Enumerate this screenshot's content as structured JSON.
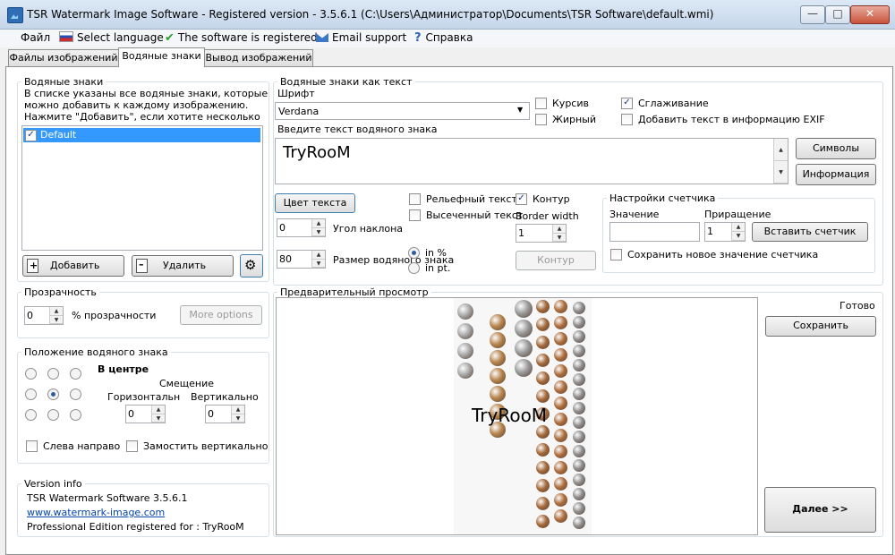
{
  "window": {
    "title": "TSR Watermark Image Software - Registered version - 3.5.6.1 (C:\\Users\\Администратор\\Documents\\TSR Software\\default.wmi)",
    "min_glyph": "—",
    "max_glyph": "□",
    "close_glyph": "✕"
  },
  "menu": {
    "file": "Файл",
    "language": "Select language",
    "registered": "The software is registered",
    "email": "Email support",
    "help": "Справка"
  },
  "tabs": [
    "Файлы изображений",
    "Водяные знаки",
    "Вывод изображений"
  ],
  "watermarks": {
    "group_label": "Водяные знаки",
    "description": [
      "В списке указаны все водяные знаки, которые",
      "можно добавить к каждому изображению.",
      "Нажмите \"Добавить\", если хотите несколько"
    ],
    "items": [
      "Default"
    ],
    "add_label": "Добавить",
    "delete_label": "Удалить"
  },
  "transparency": {
    "group_label": "Прозрачность",
    "value": "0",
    "unit_label": "% прозрачности",
    "more_options": "More options"
  },
  "position": {
    "group_label": "Положение водяного знака",
    "current": "В центре",
    "offset_label": "Смещение",
    "horizontal_label": "Горизонтальн",
    "vertical_label": "Вертикально",
    "horizontal_value": "0",
    "vertical_value": "0",
    "rtl_label": "Слева направо",
    "tile_label": "Замостить вертикально"
  },
  "version": {
    "group_label": "Version info",
    "line1": "TSR Watermark Software 3.5.6.1",
    "link": "www.watermark-image.com",
    "line3": "Professional Edition registered for : TryRooM"
  },
  "text_wm": {
    "group_label": "Водяные знаки как текст",
    "font_label": "Шрифт",
    "font_value": "Verdana",
    "italic": "Курсив",
    "bold": "Жирный",
    "smoothing": "Сглаживание",
    "exif": "Добавить текст в информацию EXIF",
    "text_prompt": "Введите текст водяного знака",
    "text_value": "TryRooM",
    "symbols_btn": "Символы",
    "info_btn": "Информация",
    "color_btn": "Цвет текста",
    "angle_value": "0",
    "angle_label": "Угол наклона",
    "size_value": "80",
    "size_label": "Размер водяного знака",
    "in_pct": "in %",
    "in_pt": "in pt.",
    "relief": "Рельефный текст",
    "raised": "Высеченный текст",
    "outline": "Контур",
    "border_width_label": "Border width",
    "border_width_value": "1",
    "outline_btn": "Контур"
  },
  "counter": {
    "group_label": "Настройки счетчика",
    "value_label": "Значение",
    "increment_label": "Приращение",
    "increment_value": "1",
    "insert_btn": "Вставить счетчик",
    "save_label": "Сохранить новое значение счетчика"
  },
  "preview": {
    "group_label": "Предварительный просмотр",
    "watermark_text": "TryRooM",
    "status": "Готово",
    "save_btn": "Сохранить",
    "next_btn": "Далее >>"
  },
  "icons": {
    "add": "add-page-icon",
    "delete": "remove-page-icon",
    "settings": "gear-icon",
    "check": "✔",
    "help": "?",
    "checkmark": "✓"
  }
}
